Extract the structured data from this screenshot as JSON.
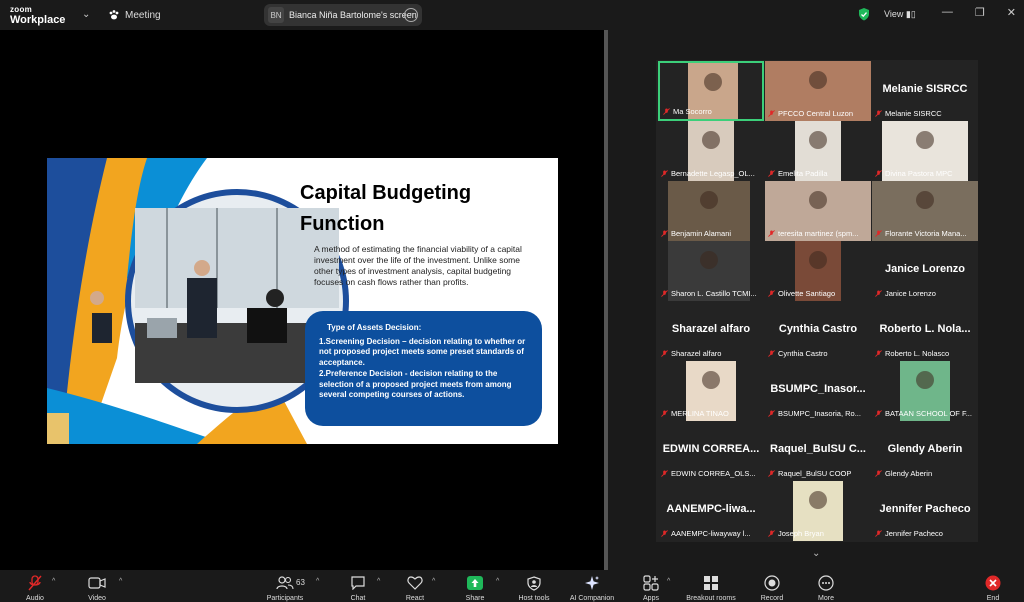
{
  "app": {
    "brand_small": "zoom",
    "brand_large": "Workplace",
    "meeting_label": "Meeting"
  },
  "share": {
    "initials": "BN",
    "screen_label": "Bianca Niña Bartolome's screen"
  },
  "view_label": "View",
  "slide": {
    "title_line1": "Capital Budgeting",
    "title_line2": "Function",
    "description": "A method of estimating the financial viability of a capital investment over the life of the investment. Unlike some other types of investment analysis, capital budgeting focuses on cash flows rather than profits.",
    "box_heading": "Type of  Assets Decision:",
    "item1": "1.Screening Decision – decision relating to whether or not proposed project meets some preset standards of acceptance.",
    "item2": "2.Preference Decision - decision relating to the selection of a proposed project meets from among several competing courses of actions."
  },
  "participants": [
    {
      "label": "Ma Socorro",
      "big": ""
    },
    {
      "label": "PFCCO Central Luzon",
      "big": ""
    },
    {
      "label": "Melanie SISRCC",
      "big": "Melanie SISRCC"
    },
    {
      "label": "Bernadette Legasp_OL...",
      "big": ""
    },
    {
      "label": "Emelita Padilla",
      "big": ""
    },
    {
      "label": "Divina Pastora MPC",
      "big": ""
    },
    {
      "label": "Benjamin Alamani",
      "big": ""
    },
    {
      "label": "teresita martinez (spm...",
      "big": ""
    },
    {
      "label": "Florante Victoria Mana...",
      "big": ""
    },
    {
      "label": "Sharon L. Castillo TCMI...",
      "big": ""
    },
    {
      "label": "Olivette Santiago",
      "big": ""
    },
    {
      "label": "Janice Lorenzo",
      "big": "Janice Lorenzo"
    },
    {
      "label": "Sharazel alfaro",
      "big": "Sharazel alfaro"
    },
    {
      "label": "Cynthia Castro",
      "big": "Cynthia Castro"
    },
    {
      "label": "Roberto L. Nolasco",
      "big": "Roberto L. Nola..."
    },
    {
      "label": "MERLINA TINAO",
      "big": ""
    },
    {
      "label": "BSUMPC_Inasoria, Ro...",
      "big": "BSUMPC_Inasor..."
    },
    {
      "label": "BATAAN SCHOOL OF F...",
      "big": ""
    },
    {
      "label": "EDWIN CORREA_OLS...",
      "big": "EDWIN  CORREA..."
    },
    {
      "label": "Raquel_BulSU COOP",
      "big": "Raquel_BulSU  C..."
    },
    {
      "label": "Glendy Aberin",
      "big": "Glendy Aberin"
    },
    {
      "label": "AANEMPC-liwayway l...",
      "big": "AANEMPC-liwa..."
    },
    {
      "label": "Joseph Bryan",
      "big": ""
    },
    {
      "label": "Jennifer Pacheco",
      "big": "Jennifer Pacheco"
    }
  ],
  "toolbar": {
    "audio": "Audio",
    "video": "Video",
    "participants": "Participants",
    "participants_count": "63",
    "chat": "Chat",
    "react": "React",
    "share": "Share",
    "host_tools": "Host tools",
    "ai_companion": "AI Companion",
    "apps": "Apps",
    "breakout": "Breakout rooms",
    "record": "Record",
    "more": "More",
    "end": "End"
  },
  "colors": {
    "accent_green": "#3ccf7a",
    "slide_blue": "#0d4f9e",
    "end_red": "#e02828",
    "share_green": "#1fb85a"
  }
}
